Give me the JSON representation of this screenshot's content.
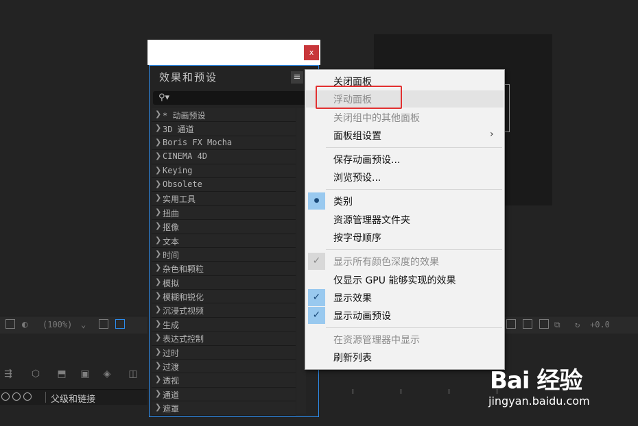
{
  "toolbar": {
    "zoom": "(100%)",
    "exposure": "+0.0"
  },
  "timeline": {
    "layer_label": "父级和链接"
  },
  "effects_panel": {
    "close": "x",
    "title": "效果和预设",
    "menu_icon": "≡",
    "search_icon": "⚲▾",
    "items": [
      {
        "label": "* 动画预设"
      },
      {
        "label": "3D 通道"
      },
      {
        "label": "Boris FX Mocha"
      },
      {
        "label": "CINEMA 4D"
      },
      {
        "label": "Keying"
      },
      {
        "label": "Obsolete"
      },
      {
        "label": "实用工具"
      },
      {
        "label": "扭曲"
      },
      {
        "label": "抠像"
      },
      {
        "label": "文本"
      },
      {
        "label": "时间"
      },
      {
        "label": "杂色和颗粒"
      },
      {
        "label": "模拟"
      },
      {
        "label": "模糊和锐化"
      },
      {
        "label": "沉浸式视频"
      },
      {
        "label": "生成"
      },
      {
        "label": "表达式控制"
      },
      {
        "label": "过时"
      },
      {
        "label": "过渡"
      },
      {
        "label": "透视"
      },
      {
        "label": "通道"
      },
      {
        "label": "遮罩"
      }
    ]
  },
  "context_menu": {
    "close_panel": "关闭面板",
    "float_panel": "浮动面板",
    "close_others": "关闭组中的其他面板",
    "panel_group_settings": "面板组设置",
    "save_preset": "保存动画预设...",
    "browse_presets": "浏览预设...",
    "category": "类别",
    "explorer_folder": "资源管理器文件夹",
    "alphabetical": "按字母顺序",
    "show_all_depths": "显示所有颜色深度的效果",
    "gpu_only": "仅显示 GPU 能够实现的效果",
    "show_effects": "显示效果",
    "show_presets": "显示动画预设",
    "show_in_explorer": "在资源管理器中显示",
    "refresh": "刷新列表",
    "submenu_arrow": "›",
    "bullet": "●",
    "check": "✓"
  },
  "watermark": {
    "logo": "Bai 经验",
    "url": "jingyan.baidu.com"
  },
  "colors": {
    "highlight": "#e23030",
    "close_button": "#c8363a",
    "panel_border": "#2d8ceb",
    "check_bg": "#99c9ef"
  }
}
